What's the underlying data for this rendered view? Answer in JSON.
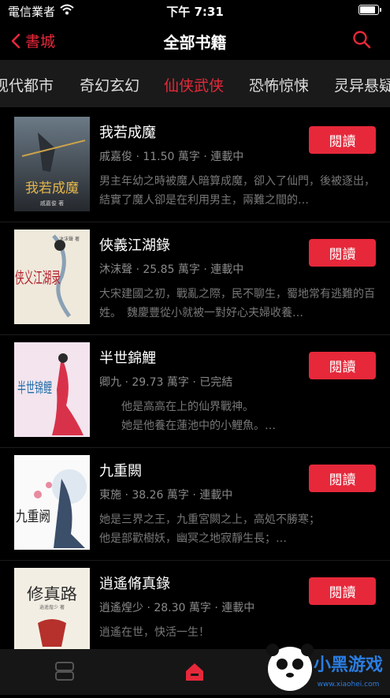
{
  "status_bar": {
    "carrier": "電信業者",
    "time": "下午 7:31"
  },
  "nav": {
    "back_label": "書城",
    "title": "全部书籍"
  },
  "tabs": [
    {
      "label": "现代都市",
      "active": false
    },
    {
      "label": "奇幻玄幻",
      "active": false
    },
    {
      "label": "仙侠武侠",
      "active": true
    },
    {
      "label": "恐怖惊悚",
      "active": false
    },
    {
      "label": "灵异悬疑",
      "active": false
    }
  ],
  "read_label": "閱讀",
  "books": [
    {
      "title": "我若成魔",
      "meta": "戚嘉俊 · 11.50 萬字 · 連載中",
      "desc": "男主年幼之時被魔人暗算成魔，卻入了仙門，後被逐出，結實了魔人卻是在利用男主，兩難之間的…",
      "cover_text": "我若成魔",
      "cover_author": "戚嘉俊 著",
      "cover_colors": [
        "#5a6a78",
        "#2c3038"
      ]
    },
    {
      "title": "俠義江湖錄",
      "meta": "沐沫聲 · 25.85 萬字 · 連載中",
      "desc": "大宋建國之初，戰亂之際，民不聊生，蜀地常有逃難的百姓。　魏慶豐從小就被一對好心夫婦收養…",
      "cover_text": "侠义江湖录",
      "cover_author": "沐沫聲 著",
      "cover_colors": [
        "#f1ece0",
        "#d9cfb8"
      ]
    },
    {
      "title": "半世錦鯉",
      "meta": "卿九 · 29.73 萬字 · 已完結",
      "desc": "　　他是高高在上的仙界戰神。\n　　她是他養在蓮池中的小鯉魚。…",
      "cover_text": "半世锦鲤",
      "cover_author": "",
      "cover_colors": [
        "#f3e6ef",
        "#e3c7d7"
      ]
    },
    {
      "title": "九重闕",
      "meta": "東施 · 38.26 萬字 · 連載中",
      "desc": "她是三界之王，九重宮闕之上，高処不勝寒；\n他是部歡樹妖，幽冥之地寂靜生長；…",
      "cover_text": "九重阙",
      "cover_author": "",
      "cover_colors": [
        "#fbfbfb",
        "#eaeaea"
      ]
    },
    {
      "title": "逍遙脩真錄",
      "meta": "逍遙煌少 · 28.30 萬字 · 連載中",
      "desc": "逍遙在世，快活一生！",
      "cover_text": "修真路",
      "cover_author": "逍遥煌少 著",
      "cover_colors": [
        "#f4efe4",
        "#e6dccb"
      ]
    }
  ],
  "watermark": {
    "brand": "小黑游戏",
    "url": "www.xiaohei.com"
  },
  "colors": {
    "accent": "#e6283a",
    "background": "#000000",
    "tab_bar": "#1a1a1a"
  }
}
